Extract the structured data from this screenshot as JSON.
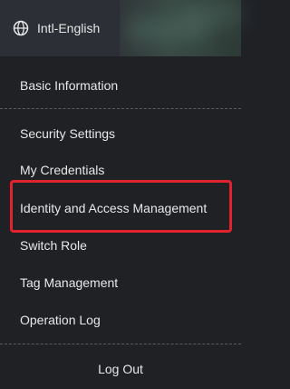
{
  "topbar": {
    "language_label": "Intl-English",
    "language_icon": "globe-icon"
  },
  "menu": {
    "items": [
      {
        "label": "Basic Information"
      },
      {
        "label": "Security Settings"
      },
      {
        "label": "My Credentials"
      },
      {
        "label": "Identity and Access Management"
      },
      {
        "label": "Switch Role"
      },
      {
        "label": "Tag Management"
      },
      {
        "label": "Operation Log"
      }
    ],
    "logout_label": "Log Out"
  },
  "colors": {
    "background": "#1f2125",
    "highlight_border": "#e0232e",
    "text": "#e8e8e8"
  }
}
